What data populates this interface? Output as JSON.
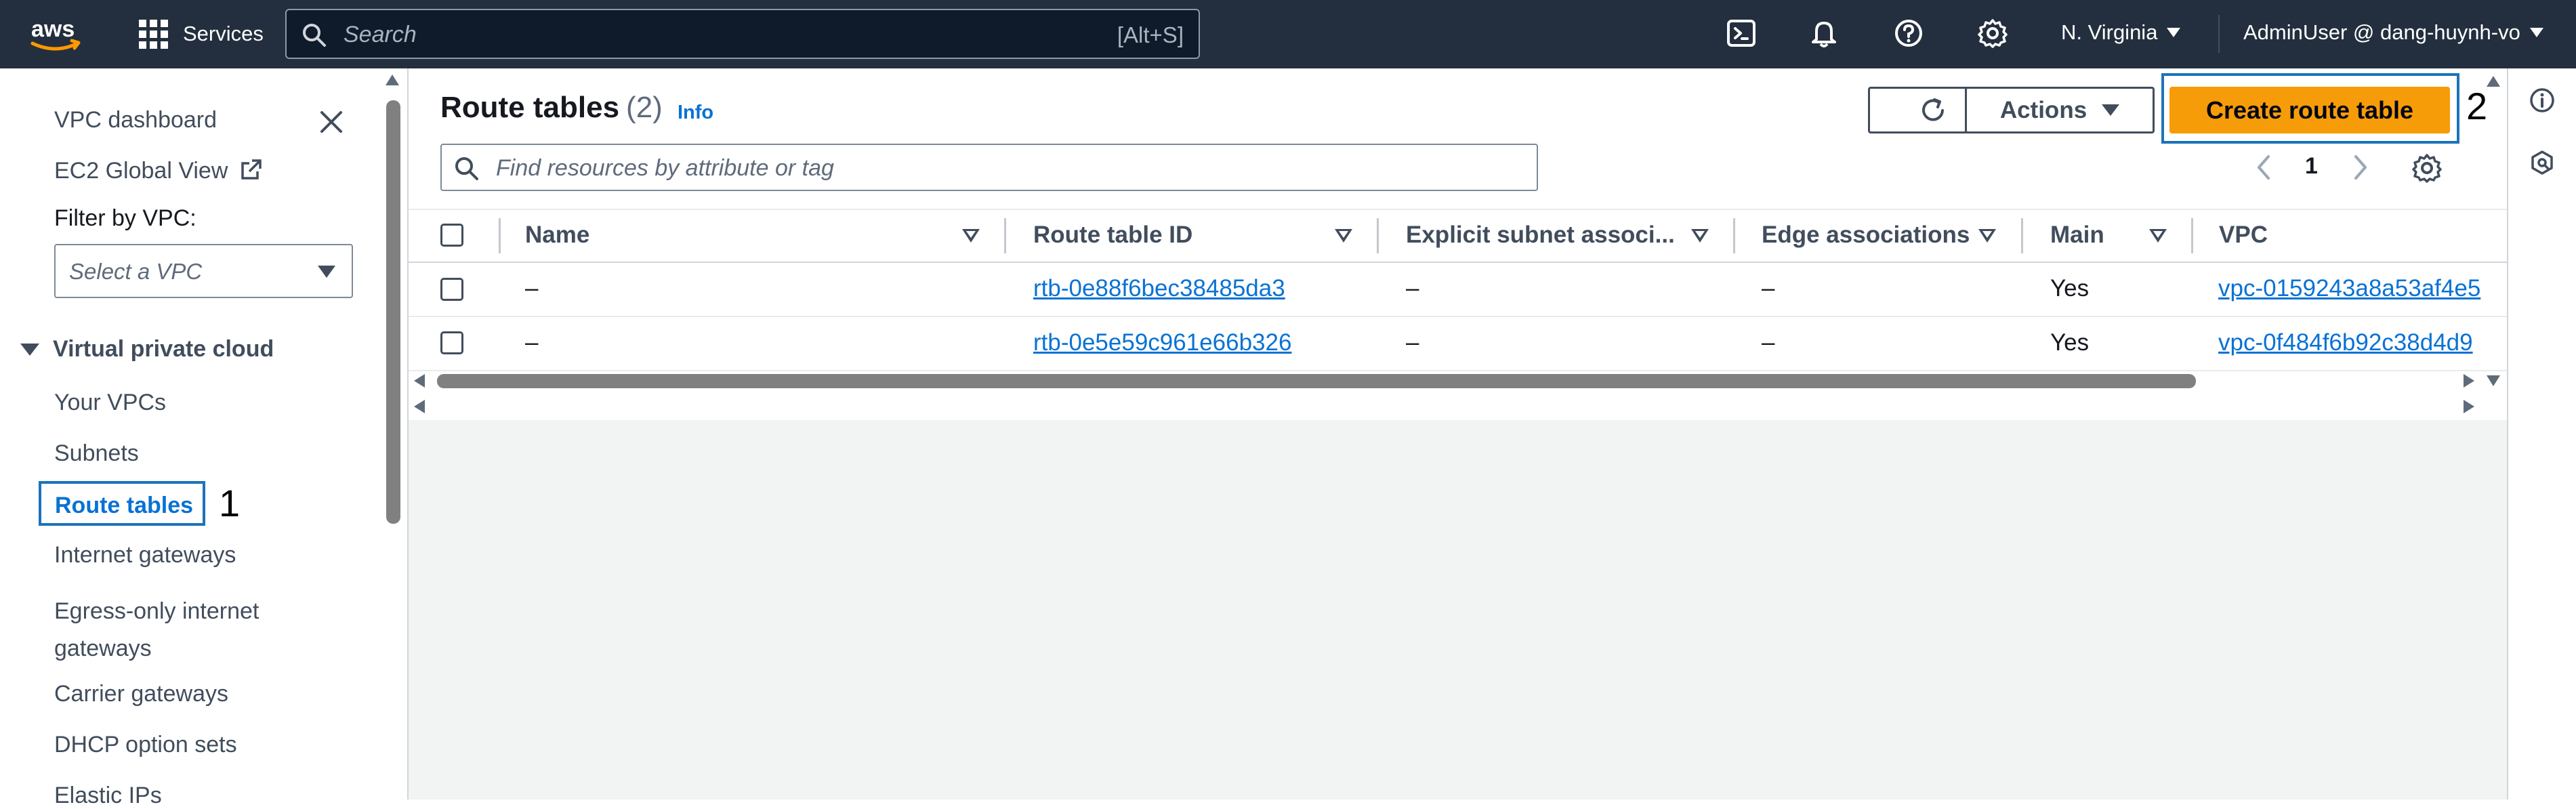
{
  "topbar": {
    "logo_text": "aws",
    "services_label": "Services",
    "search_placeholder": "Search",
    "search_shortcut": "[Alt+S]",
    "icons": [
      "cloudshell-icon",
      "notifications-bell-icon",
      "help-icon",
      "settings-gear-icon"
    ],
    "region": "N. Virginia",
    "user": "AdminUser @ dang-huynh-vo"
  },
  "sidebar": {
    "dashboard": "VPC dashboard",
    "ec2_global": "EC2 Global View",
    "filter_label": "Filter by VPC:",
    "filter_placeholder": "Select a VPC",
    "section": "Virtual private cloud",
    "items": [
      {
        "label": "Your VPCs"
      },
      {
        "label": "Subnets"
      },
      {
        "label": "Route tables"
      },
      {
        "label": "Internet gateways"
      },
      {
        "label": "Egress-only internet gateways"
      },
      {
        "label": "Carrier gateways"
      },
      {
        "label": "DHCP option sets"
      },
      {
        "label": "Elastic IPs"
      }
    ],
    "active_item": "Route tables"
  },
  "annotations": {
    "marker_1": "1",
    "marker_2": "2"
  },
  "header": {
    "title": "Route tables",
    "count": "(2)",
    "info": "Info",
    "actions_label": "Actions",
    "create_label": "Create route table",
    "find_placeholder": "Find resources by attribute or tag",
    "page_number": "1"
  },
  "table": {
    "columns": [
      "Name",
      "Route table ID",
      "Explicit subnet associ...",
      "Edge associations",
      "Main",
      "VPC"
    ],
    "rows": [
      {
        "name": "–",
        "id": "rtb-0e88f6bec38485da3",
        "explicit": "–",
        "edge": "–",
        "main": "Yes",
        "vpc": "vpc-0159243a8a53af4e5"
      },
      {
        "name": "–",
        "id": "rtb-0e5e59c961e66b326",
        "explicit": "–",
        "edge": "–",
        "main": "Yes",
        "vpc": "vpc-0f484f6b92c38d4d9"
      }
    ]
  },
  "colors": {
    "topbar": "#232f3e",
    "accent_link": "#0972d3",
    "primary_button": "#f79c09",
    "highlight_box": "#1b73bb"
  }
}
